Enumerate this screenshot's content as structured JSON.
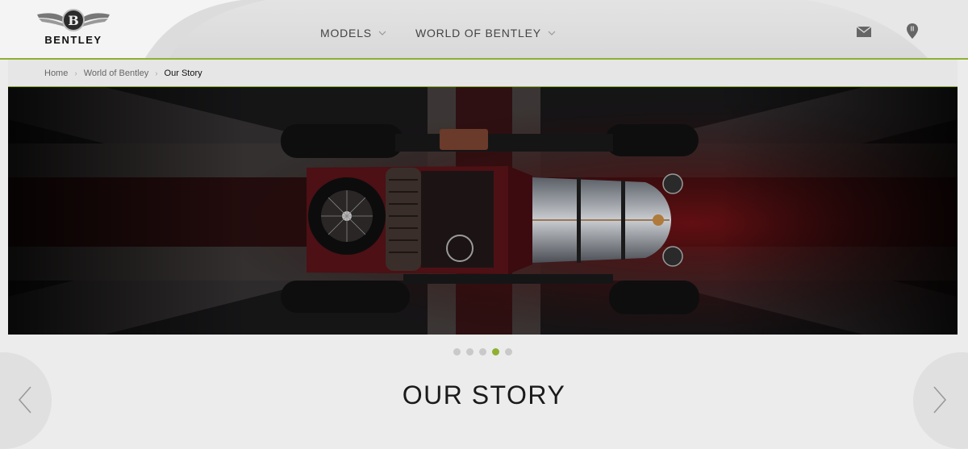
{
  "header": {
    "brand": "BENTLEY",
    "nav": [
      {
        "label": "MODELS"
      },
      {
        "label": "WORLD OF BENTLEY"
      }
    ],
    "icons": [
      "mail-icon",
      "location-pin-icon"
    ],
    "accent_color": "#8fb031"
  },
  "breadcrumb": {
    "items": [
      "Home",
      "World of Bentley"
    ],
    "current": "Our Story"
  },
  "hero": {
    "image": "vintage-bentley-top-view-on-union-jack"
  },
  "carousel": {
    "slide_count": 5,
    "active_index": 3
  },
  "page": {
    "title": "OUR STORY"
  }
}
